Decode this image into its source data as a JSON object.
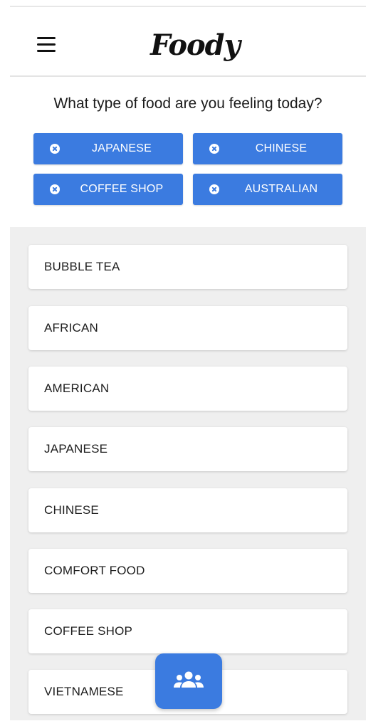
{
  "header": {
    "brand": "Foody",
    "menu_icon": "hamburger-menu-icon"
  },
  "question": "What type of food are you feeling today?",
  "selected_chips": [
    {
      "label": "JAPANESE",
      "icon": "remove-circle-icon"
    },
    {
      "label": "CHINESE",
      "icon": "remove-circle-icon"
    },
    {
      "label": "COFFEE SHOP",
      "icon": "remove-circle-icon"
    },
    {
      "label": "AUSTRALIAN",
      "icon": "remove-circle-icon"
    }
  ],
  "cuisines": [
    "BUBBLE TEA",
    "AFRICAN",
    "AMERICAN",
    "JAPANESE",
    "CHINESE",
    "COMFORT FOOD",
    "COFFEE SHOP",
    "VIETNAMESE"
  ],
  "fab": {
    "icon": "group-users-icon"
  },
  "colors": {
    "accent": "#3b7be0",
    "list_background": "#efefef",
    "text": "#1d1d1d"
  }
}
